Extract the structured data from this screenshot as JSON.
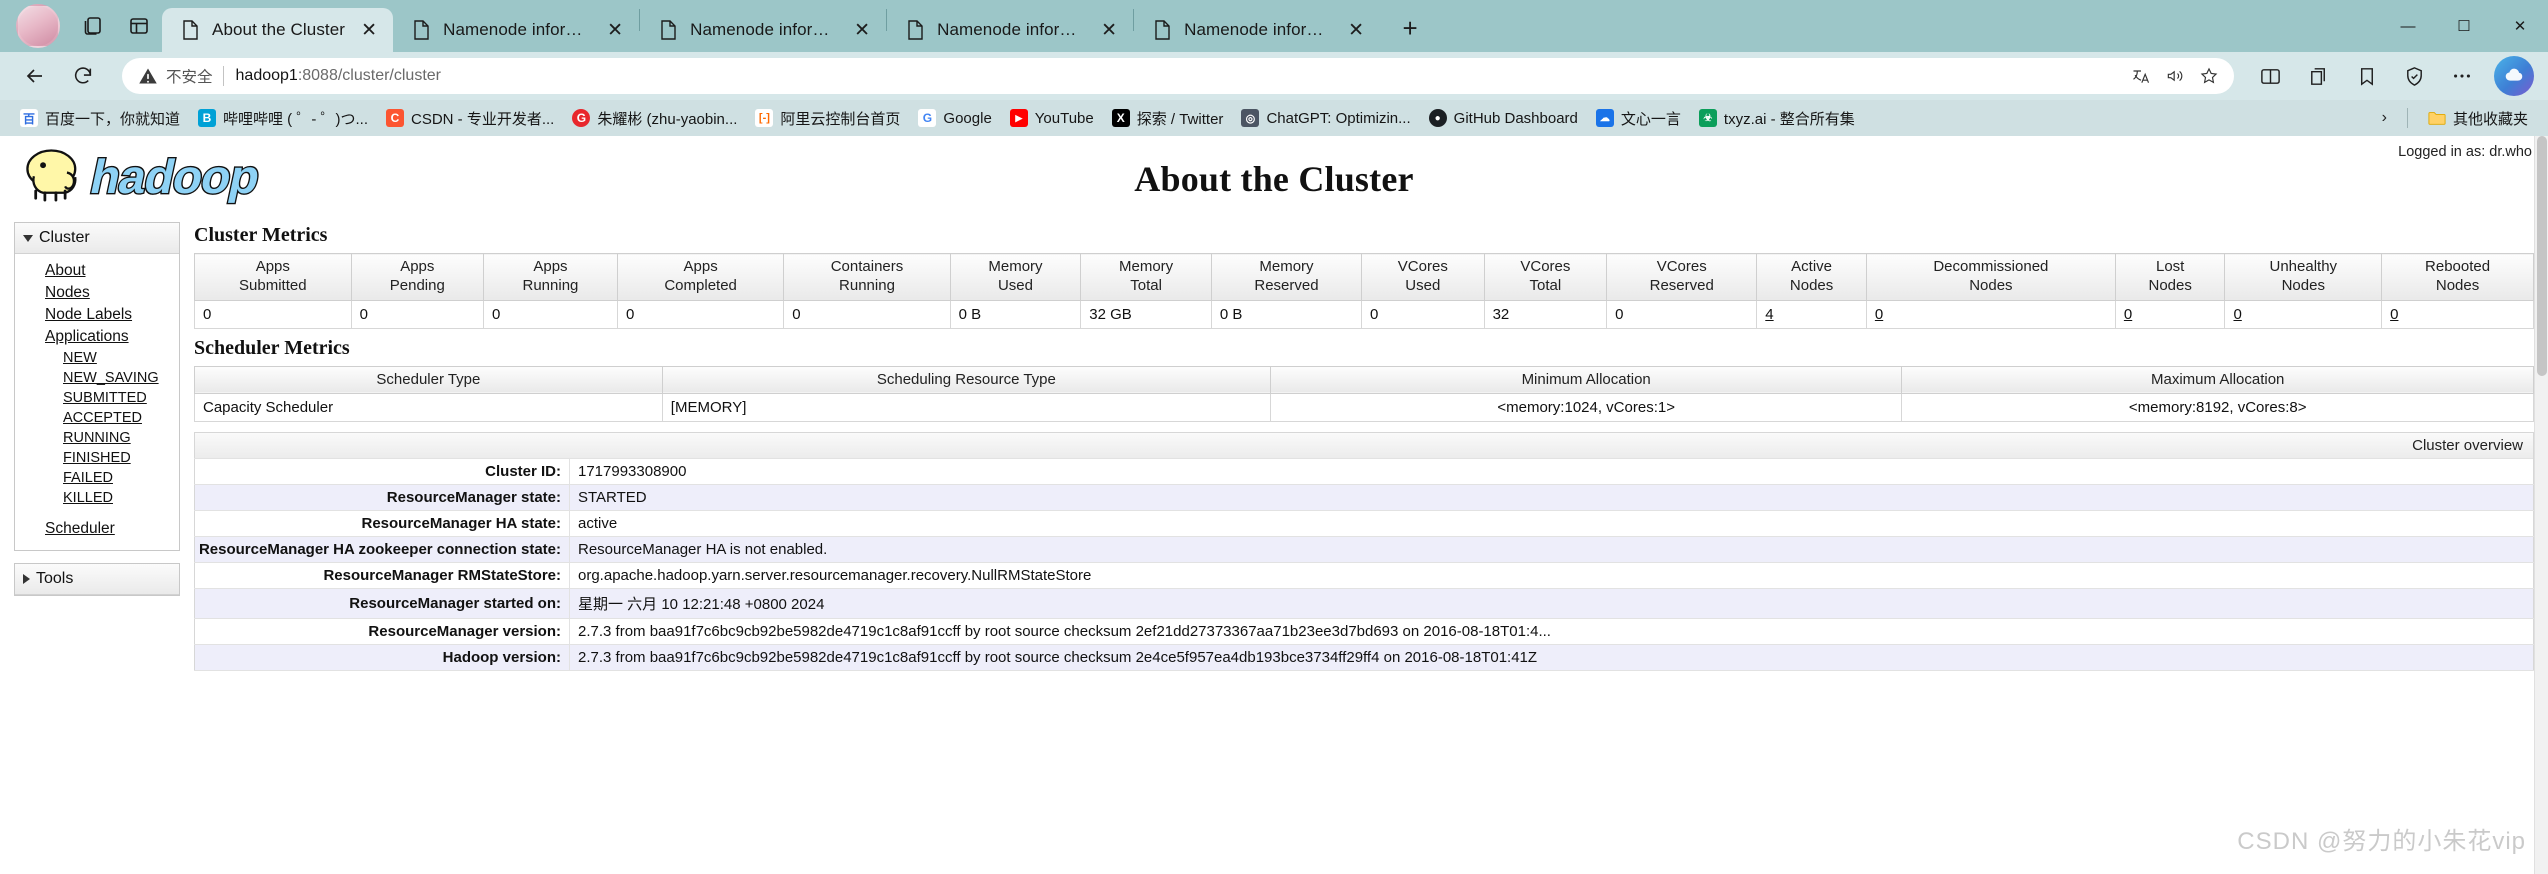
{
  "browser": {
    "tabs": [
      {
        "title": "About the Cluster",
        "active": true
      },
      {
        "title": "Namenode information",
        "active": false
      },
      {
        "title": "Namenode information",
        "active": false
      },
      {
        "title": "Namenode information",
        "active": false
      },
      {
        "title": "Namenode information",
        "active": false
      }
    ],
    "new_tab_label": "+",
    "window_controls": {
      "minimize": "—",
      "maximize": "☐",
      "close": "✕"
    },
    "nav": {
      "back": "←",
      "reload": "↻"
    },
    "omnibox": {
      "security_text": "不安全",
      "url_host": "hadoop1",
      "url_path": ":8088/cluster/cluster",
      "translate_icon": "translate-icon",
      "read_aloud_icon": "read-aloud-icon",
      "favorite_icon": "star-icon"
    },
    "toolbar_right": {
      "split_screen": "split-screen-icon",
      "collections": "collections-icon",
      "favorites": "favorites-icon",
      "browser_essentials": "browser-essentials-icon",
      "settings_more": "more-icon",
      "copilot": "copilot-icon"
    },
    "bookmarks": [
      {
        "label": "百度一下，你就知道",
        "icon_text": "百",
        "icon_color": "#2f6ee0",
        "icon_bg": "#ffffff"
      },
      {
        "label": "哔哩哔哩 ( ゜- ゜)つ...",
        "icon_text": "B",
        "icon_color": "#ffffff",
        "icon_bg": "#00a1d6"
      },
      {
        "label": "CSDN - 专业开发者...",
        "icon_text": "C",
        "icon_color": "#ffffff",
        "icon_bg": "#fc5531"
      },
      {
        "label": "朱耀彬 (zhu-yaobin...",
        "icon_text": "G",
        "icon_color": "#ffffff",
        "icon_bg": "#e8272c"
      },
      {
        "label": "阿里云控制台首页",
        "icon_text": "[-]",
        "icon_color": "#ff6a00",
        "icon_bg": "#ffffff"
      },
      {
        "label": "Google",
        "icon_text": "G",
        "icon_color": "#4285f4",
        "icon_bg": "#ffffff"
      },
      {
        "label": "YouTube",
        "icon_text": "▶",
        "icon_color": "#ffffff",
        "icon_bg": "#ff0000"
      },
      {
        "label": "探索 / Twitter",
        "icon_text": "X",
        "icon_color": "#ffffff",
        "icon_bg": "#000000"
      },
      {
        "label": "ChatGPT: Optimizin...",
        "icon_text": "◎",
        "icon_color": "#ffffff",
        "icon_bg": "#4b5563"
      },
      {
        "label": "GitHub Dashboard",
        "icon_text": "●",
        "icon_color": "#ffffff",
        "icon_bg": "#1b1f23"
      },
      {
        "label": "文心一言",
        "icon_text": "☁",
        "icon_color": "#ffffff",
        "icon_bg": "#1a73e8"
      },
      {
        "label": "txyz.ai - 整合所有集",
        "icon_text": "☘",
        "icon_color": "#ffffff",
        "icon_bg": "#0b9e5a"
      }
    ],
    "bookmarks_overflow": "›",
    "other_favorites": {
      "label": "其他收藏夹",
      "icon": "folder-icon"
    }
  },
  "page": {
    "logged_in": "Logged in as: dr.who",
    "logo_alt": "hadoop",
    "title": "About the Cluster",
    "sidebar": {
      "cluster": {
        "header": "Cluster",
        "items": [
          {
            "label": "About"
          },
          {
            "label": "Nodes"
          },
          {
            "label": "Node Labels"
          },
          {
            "label": "Applications"
          }
        ],
        "app_states": [
          {
            "label": "NEW"
          },
          {
            "label": "NEW_SAVING"
          },
          {
            "label": "SUBMITTED"
          },
          {
            "label": "ACCEPTED"
          },
          {
            "label": "RUNNING"
          },
          {
            "label": "FINISHED"
          },
          {
            "label": "FAILED"
          },
          {
            "label": "KILLED"
          }
        ],
        "scheduler": "Scheduler"
      },
      "tools": {
        "header": "Tools"
      }
    },
    "cluster_metrics": {
      "heading": "Cluster Metrics",
      "columns": [
        "Apps\nSubmitted",
        "Apps\nPending",
        "Apps\nRunning",
        "Apps\nCompleted",
        "Containers\nRunning",
        "Memory\nUsed",
        "Memory\nTotal",
        "Memory\nReserved",
        "VCores\nUsed",
        "VCores\nTotal",
        "VCores\nReserved",
        "Active\nNodes",
        "Decommissioned\nNodes",
        "Lost\nNodes",
        "Unhealthy\nNodes",
        "Rebooted\nNodes"
      ],
      "values": [
        "0",
        "0",
        "0",
        "0",
        "0",
        "0 B",
        "32 GB",
        "0 B",
        "0",
        "32",
        "0",
        "4",
        "0",
        "0",
        "0",
        "0"
      ],
      "linked": [
        false,
        false,
        false,
        false,
        false,
        false,
        false,
        false,
        false,
        false,
        false,
        true,
        true,
        true,
        true,
        true
      ]
    },
    "scheduler_metrics": {
      "heading": "Scheduler Metrics",
      "columns": [
        "Scheduler Type",
        "Scheduling Resource Type",
        "Minimum Allocation",
        "Maximum Allocation"
      ],
      "row": [
        "Capacity Scheduler",
        "[MEMORY]",
        "<memory:1024, vCores:1>",
        "<memory:8192, vCores:8>"
      ]
    },
    "cluster_overview": {
      "caption": "Cluster overview",
      "rows": [
        {
          "key": "Cluster ID:",
          "value": "1717993308900"
        },
        {
          "key": "ResourceManager state:",
          "value": "STARTED"
        },
        {
          "key": "ResourceManager HA state:",
          "value": "active"
        },
        {
          "key": "ResourceManager HA zookeeper connection state:",
          "value": "ResourceManager HA is not enabled."
        },
        {
          "key": "ResourceManager RMStateStore:",
          "value": "org.apache.hadoop.yarn.server.resourcemanager.recovery.NullRMStateStore"
        },
        {
          "key": "ResourceManager started on:",
          "value": "星期一 六月 10 12:21:48 +0800 2024"
        },
        {
          "key": "ResourceManager version:",
          "value": "2.7.3 from baa91f7c6bc9cb92be5982de4719c1c8af91ccff by root source checksum 2ef21dd27373367aa71b23ee3d7bd693 on 2016-08-18T01:4..."
        },
        {
          "key": "Hadoop version:",
          "value": "2.7.3 from baa91f7c6bc9cb92be5982de4719c1c8af91ccff by root source checksum 2e4ce5f957ea4db193bce3734ff29ff4 on 2016-08-18T01:41Z"
        }
      ]
    },
    "watermark": "CSDN @努力的小朱花vip"
  }
}
